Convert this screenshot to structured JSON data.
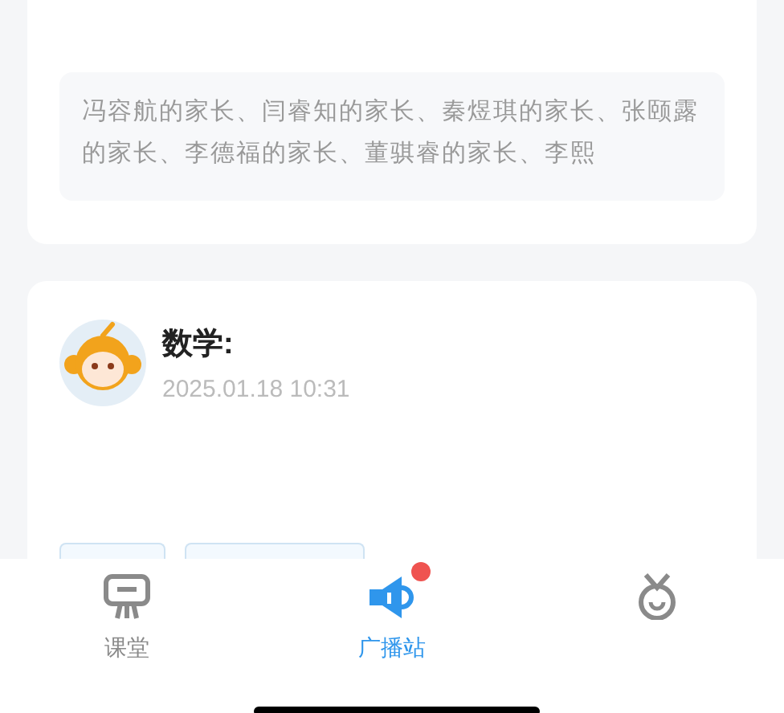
{
  "notice_card": {
    "recipients": "冯容航的家长、闫睿知的家长、秦煜琪的家长、张颐露的家长、李德福的家长、董骐睿的家长、李熙"
  },
  "post": {
    "title": "数学:",
    "time": "2025.01.18 10:31"
  },
  "tabs": [
    {
      "kind": "classroom",
      "label": "课堂",
      "selected": false,
      "unread": false
    },
    {
      "kind": "broadcast",
      "label": "广播站",
      "selected": true,
      "unread": true
    },
    {
      "kind": "mascot",
      "selected": false,
      "unread": false
    }
  ]
}
